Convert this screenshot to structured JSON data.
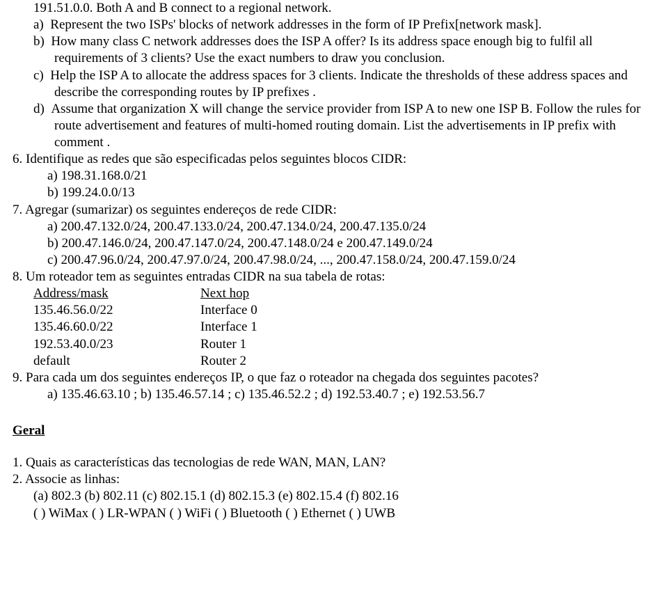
{
  "line_intro": "191.51.0.0. Both A and B connect to a regional network.",
  "q_block": {
    "a_label": "a)",
    "a_text": "Represent the two ISPs' blocks of network addresses in the form of IP Prefix[network mask].",
    "b_label": "b)",
    "b_text": "How many class C network addresses does the ISP A offer? Is its address space enough big to fulfil all requirements of 3 clients? Use the exact numbers to draw you conclusion.",
    "c_label": "c)",
    "c_text": "Help the ISP A to allocate the address spaces for 3 clients. Indicate the thresholds of these address spaces and describe the corresponding routes by IP prefixes .",
    "d_label": "d)",
    "d_text": "Assume that organization X will change the service provider from ISP A to new one ISP B. Follow the rules for route advertisement and features of multi-homed routing domain. List the advertisements in IP prefix with comment ."
  },
  "q6": {
    "num": "6. Identifique as redes que são especificadas pelos seguintes blocos CIDR:",
    "a": "a) 198.31.168.0/21",
    "b": "b) 199.24.0.0/13"
  },
  "q7": {
    "num": "7. Agregar (sumarizar) os seguintes endereços de rede CIDR:",
    "a": "a) 200.47.132.0/24, 200.47.133.0/24, 200.47.134.0/24, 200.47.135.0/24",
    "b": "b) 200.47.146.0/24, 200.47.147.0/24, 200.47.148.0/24 e 200.47.149.0/24",
    "c": "c) 200.47.96.0/24, 200.47.97.0/24, 200.47.98.0/24, ..., 200.47.158.0/24, 200.47.159.0/24"
  },
  "q8": {
    "num": "8. Um roteador tem as seguintes entradas CIDR na sua tabela de rotas:",
    "hdr_a": "Address/mask",
    "hdr_b": "Next hop",
    "rows": [
      {
        "a": "135.46.56.0/22",
        "b": "Interface 0"
      },
      {
        "a": "135.46.60.0/22",
        "b": "Interface 1"
      },
      {
        "a": "192.53.40.0/23",
        "b": "Router 1"
      },
      {
        "a": "default",
        "b": "Router 2"
      }
    ]
  },
  "q9": {
    "num": "9. Para cada um dos seguintes endereços IP, o que faz o roteador na chegada dos seguintes pacotes?",
    "a": "a) 135.46.63.10 ;  b) 135.46.57.14 ;  c) 135.46.52.2 ;  d) 192.53.40.7 ;  e) 192.53.56.7"
  },
  "geral_heading": "Geral",
  "g1": "1.  Quais as características das tecnologias de rede WAN, MAN, LAN?",
  "g2_num": "2.  Associe as linhas:",
  "g2_line1": "(a) 802.3  (b) 802.11  (c) 802.15.1  (d) 802.15.3  (e) 802.15.4  (f) 802.16",
  "g2_line2": "( ) WiMax  ( ) LR-WPAN  ( ) WiFi  ( ) Bluetooth  ( ) Ethernet  ( ) UWB"
}
